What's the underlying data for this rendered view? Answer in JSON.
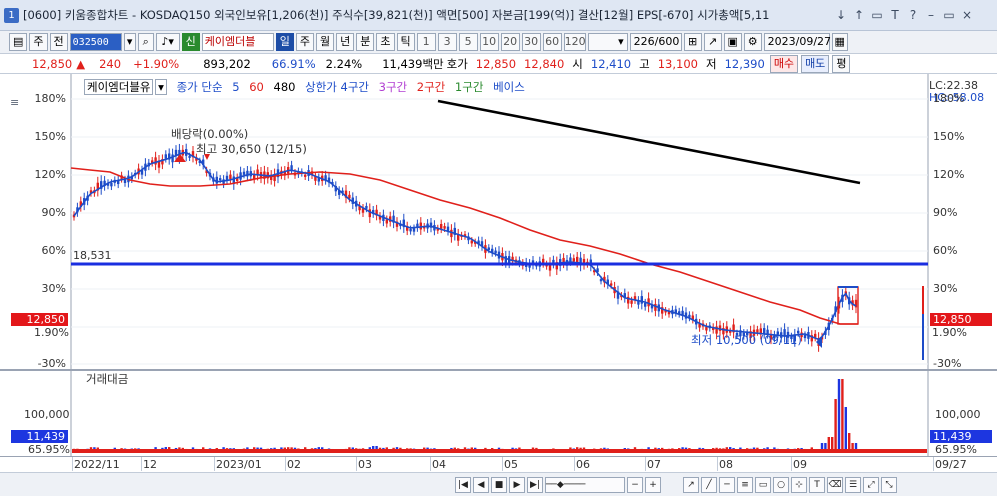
{
  "window": {
    "number": "1",
    "title": "[0600] 키움종합차트 - KOSDAQ150 외국인보유[1,206(천)] 주식수[39,821(천)] 액면[500] 자본금[199(억)] 결산[12월] EPS[-670] 시가총액[5,11",
    "buttons": [
      "↓",
      "↑",
      "▭",
      "T",
      "?",
      "–",
      "▭",
      "×"
    ]
  },
  "toolbar": {
    "market": "주",
    "mode": "전",
    "code": "032500",
    "name_prefix": "신",
    "stock_name": "케이엠더블",
    "periods": [
      "일",
      "주",
      "월",
      "년",
      "분",
      "초",
      "틱"
    ],
    "active_period": "일",
    "intervals": [
      "1",
      "3",
      "5",
      "10",
      "20",
      "30",
      "60",
      "120"
    ],
    "count": "226/600",
    "date": "2023/09/27"
  },
  "quote": {
    "price": "12,850",
    "arrow": "▲",
    "change": "240",
    "change_pct": "+1.90%",
    "volume": "893,202",
    "ratio": "66.91%",
    "turnover": "2.24%",
    "amount": "11,439백만",
    "hoga_label": "호가",
    "ask": "12,850",
    "bid": "12,840",
    "open_label": "시",
    "open": "12,410",
    "high_label": "고",
    "high": "13,100",
    "low_label": "저",
    "low": "12,390",
    "buy_label": "매수",
    "sell_label": "매도",
    "eval_label": "평"
  },
  "legend": {
    "stock": "케이엠더블유",
    "ma_label": "종가 단순",
    "ma1": "5",
    "ma2": "60",
    "ma3": "480",
    "band": "상한가 4구간",
    "z3": "3구간",
    "z2": "2구간",
    "z1": "1구간",
    "base": "베이스"
  },
  "annotations": {
    "dividend": "배당락(0.00%)",
    "high": "최고 30,650 (12/15)",
    "low": "최저 10,500 (09/11)",
    "level": "18,531",
    "lc": "LC:22.38",
    "hc": "HC:-58.08"
  },
  "left_axis": [
    "180%",
    "150%",
    "120%",
    "90%",
    "60%",
    "30%",
    "0%",
    "-30%"
  ],
  "right_axis": [
    "180%",
    "150%",
    "120%",
    "90%",
    "60%",
    "30%",
    "0%",
    "-30%"
  ],
  "price_tag": {
    "value": "12,850",
    "pct": "1.90%"
  },
  "volume_panel": {
    "title": "거래대금",
    "tick": "100,000",
    "value": "11,439",
    "pct": "65.95%"
  },
  "x_labels": [
    "2022/11",
    "12",
    "2023/01",
    "02",
    "03",
    "04",
    "05",
    "06",
    "07",
    "08",
    "09",
    "09/27"
  ],
  "colors": {
    "rise": "#e0201b",
    "fall": "#1d4cc8",
    "ma5": "#1d4cc8",
    "ma60": "#e0201b",
    "ma480": "#000000",
    "level_line": "#1a2ee0"
  }
}
